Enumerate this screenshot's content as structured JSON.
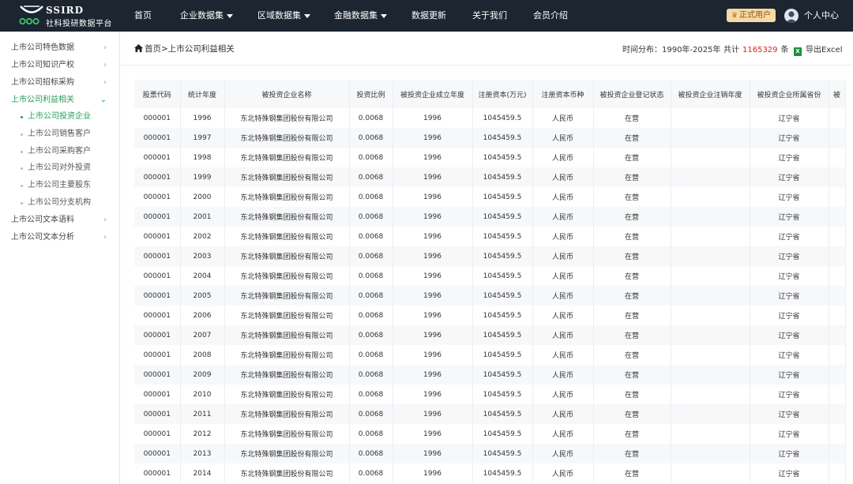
{
  "brand": {
    "title": "SSIRD",
    "subtitle": "社科投研数据平台",
    "logo_icon": "ssird-logo-icon"
  },
  "nav": {
    "items": [
      {
        "label": "首页",
        "dropdown": false
      },
      {
        "label": "企业数据集",
        "dropdown": true
      },
      {
        "label": "区域数据集",
        "dropdown": true
      },
      {
        "label": "金融数据集",
        "dropdown": true
      },
      {
        "label": "数据更新",
        "dropdown": false
      },
      {
        "label": "关于我们",
        "dropdown": false
      },
      {
        "label": "会员介绍",
        "dropdown": false
      }
    ],
    "vip_label": "正式用户",
    "user_center": "个人中心"
  },
  "sidebar": {
    "items": [
      {
        "label": "上市公司特色数据",
        "active": false,
        "expanded": false
      },
      {
        "label": "上市公司知识产权",
        "active": false,
        "expanded": false
      },
      {
        "label": "上市公司招标采购",
        "active": false,
        "expanded": false
      },
      {
        "label": "上市公司利益相关",
        "active": true,
        "expanded": true
      },
      {
        "label": "上市公司文本语料",
        "active": false,
        "expanded": false
      },
      {
        "label": "上市公司文本分析",
        "active": false,
        "expanded": false
      }
    ],
    "sub_items": [
      {
        "label": "上市公司投资企业",
        "active": true
      },
      {
        "label": "上市公司销售客户",
        "active": false
      },
      {
        "label": "上市公司采购客户",
        "active": false
      },
      {
        "label": "上市公司对外投资",
        "active": false
      },
      {
        "label": "上市公司主要股东",
        "active": false
      },
      {
        "label": "上市公司分支机构",
        "active": false
      }
    ]
  },
  "header": {
    "breadcrumb": "首页>上市公司利益相关",
    "time_range": "时间分布：1990年-2025年",
    "total_prefix": "共计",
    "total_count": "1165329",
    "total_suffix": "条",
    "export_label": "导出Excel"
  },
  "table": {
    "columns": [
      "股票代码",
      "统计年度",
      "被投资企业名称",
      "投资比例",
      "被投资企业成立年度",
      "注册资本(万元)",
      "注册资本币种",
      "被投资企业登记状态",
      "被投资企业注销年度",
      "被投资企业所属省份",
      "被"
    ],
    "rows": [
      [
        "000001",
        "1996",
        "东北特殊钢集团股份有限公司",
        "0.0068",
        "1996",
        "1045459.5",
        "人民币",
        "在营",
        "",
        "辽宁省",
        ""
      ],
      [
        "000001",
        "1997",
        "东北特殊钢集团股份有限公司",
        "0.0068",
        "1996",
        "1045459.5",
        "人民币",
        "在营",
        "",
        "辽宁省",
        ""
      ],
      [
        "000001",
        "1998",
        "东北特殊钢集团股份有限公司",
        "0.0068",
        "1996",
        "1045459.5",
        "人民币",
        "在营",
        "",
        "辽宁省",
        ""
      ],
      [
        "000001",
        "1999",
        "东北特殊钢集团股份有限公司",
        "0.0068",
        "1996",
        "1045459.5",
        "人民币",
        "在营",
        "",
        "辽宁省",
        ""
      ],
      [
        "000001",
        "2000",
        "东北特殊钢集团股份有限公司",
        "0.0068",
        "1996",
        "1045459.5",
        "人民币",
        "在营",
        "",
        "辽宁省",
        ""
      ],
      [
        "000001",
        "2001",
        "东北特殊钢集团股份有限公司",
        "0.0068",
        "1996",
        "1045459.5",
        "人民币",
        "在营",
        "",
        "辽宁省",
        ""
      ],
      [
        "000001",
        "2002",
        "东北特殊钢集团股份有限公司",
        "0.0068",
        "1996",
        "1045459.5",
        "人民币",
        "在营",
        "",
        "辽宁省",
        ""
      ],
      [
        "000001",
        "2003",
        "东北特殊钢集团股份有限公司",
        "0.0068",
        "1996",
        "1045459.5",
        "人民币",
        "在营",
        "",
        "辽宁省",
        ""
      ],
      [
        "000001",
        "2004",
        "东北特殊钢集团股份有限公司",
        "0.0068",
        "1996",
        "1045459.5",
        "人民币",
        "在营",
        "",
        "辽宁省",
        ""
      ],
      [
        "000001",
        "2005",
        "东北特殊钢集团股份有限公司",
        "0.0068",
        "1996",
        "1045459.5",
        "人民币",
        "在营",
        "",
        "辽宁省",
        ""
      ],
      [
        "000001",
        "2006",
        "东北特殊钢集团股份有限公司",
        "0.0068",
        "1996",
        "1045459.5",
        "人民币",
        "在营",
        "",
        "辽宁省",
        ""
      ],
      [
        "000001",
        "2007",
        "东北特殊钢集团股份有限公司",
        "0.0068",
        "1996",
        "1045459.5",
        "人民币",
        "在营",
        "",
        "辽宁省",
        ""
      ],
      [
        "000001",
        "2008",
        "东北特殊钢集团股份有限公司",
        "0.0068",
        "1996",
        "1045459.5",
        "人民币",
        "在营",
        "",
        "辽宁省",
        ""
      ],
      [
        "000001",
        "2009",
        "东北特殊钢集团股份有限公司",
        "0.0068",
        "1996",
        "1045459.5",
        "人民币",
        "在营",
        "",
        "辽宁省",
        ""
      ],
      [
        "000001",
        "2010",
        "东北特殊钢集团股份有限公司",
        "0.0068",
        "1996",
        "1045459.5",
        "人民币",
        "在营",
        "",
        "辽宁省",
        ""
      ],
      [
        "000001",
        "2011",
        "东北特殊钢集团股份有限公司",
        "0.0068",
        "1996",
        "1045459.5",
        "人民币",
        "在营",
        "",
        "辽宁省",
        ""
      ],
      [
        "000001",
        "2012",
        "东北特殊钢集团股份有限公司",
        "0.0068",
        "1996",
        "1045459.5",
        "人民币",
        "在营",
        "",
        "辽宁省",
        ""
      ],
      [
        "000001",
        "2013",
        "东北特殊钢集团股份有限公司",
        "0.0068",
        "1996",
        "1045459.5",
        "人民币",
        "在营",
        "",
        "辽宁省",
        ""
      ],
      [
        "000001",
        "2014",
        "东北特殊钢集团股份有限公司",
        "0.0068",
        "1996",
        "1045459.5",
        "人民币",
        "在营",
        "",
        "辽宁省",
        ""
      ]
    ]
  },
  "colors": {
    "topbar_bg": "#1c2530",
    "accent_green": "#1f9d55",
    "count_red": "#e02020",
    "vip_gold": "#f6d9a5"
  }
}
